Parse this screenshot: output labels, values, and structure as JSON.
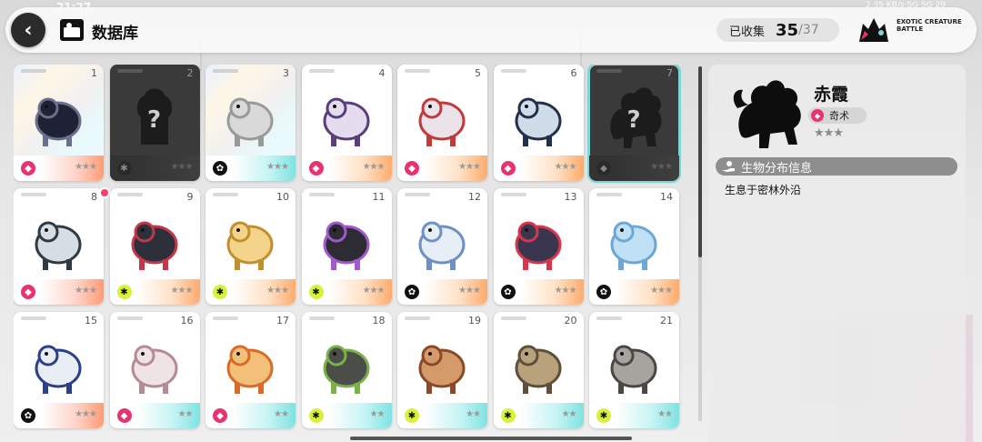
{
  "status_bar": {
    "time": "21:27",
    "right_text": "2.35 KB/s  5G  5G  29"
  },
  "header": {
    "back_icon": "chevron-left-icon",
    "title": "数据库",
    "collected_label": "已收集",
    "collected_count": "35",
    "collected_total": "/37",
    "logo_text": "EXOTIC CREATURE BATTLE"
  },
  "cards": [
    {
      "num": "1",
      "type": "arcane",
      "stars": "★★★",
      "state": "holo",
      "footer": "pink",
      "art": "dragon-dark"
    },
    {
      "num": "2",
      "type": "nature",
      "stars": "★★★",
      "state": "locked",
      "footer": "dark",
      "art": "unknown"
    },
    {
      "num": "3",
      "type": "dark",
      "stars": "★★★",
      "state": "holo",
      "footer": "cyan",
      "art": "statue"
    },
    {
      "num": "4",
      "type": "arcane",
      "stars": "★★★",
      "state": "normal",
      "footer": "orange",
      "art": "sheep-witch"
    },
    {
      "num": "5",
      "type": "arcane",
      "stars": "★★★",
      "state": "normal",
      "footer": "orange",
      "art": "sheep-red"
    },
    {
      "num": "6",
      "type": "arcane",
      "stars": "★★★",
      "state": "normal",
      "footer": "orange",
      "art": "sea-dragon"
    },
    {
      "num": "7",
      "type": "arcane",
      "stars": "★★★",
      "state": "locked-selected",
      "footer": "dark",
      "art": "unknown-dragon"
    },
    {
      "num": "8",
      "type": "arcane",
      "stars": "★★★",
      "state": "normal",
      "footer": "pink",
      "art": "mushroom-beast"
    },
    {
      "num": "9",
      "type": "nature",
      "stars": "★★★",
      "state": "normal",
      "footer": "orange",
      "art": "crab-spider"
    },
    {
      "num": "10",
      "type": "nature",
      "stars": "★★★",
      "state": "normal",
      "footer": "orange",
      "art": "cat"
    },
    {
      "num": "11",
      "type": "nature",
      "stars": "★★★",
      "state": "normal",
      "footer": "orange",
      "art": "golem"
    },
    {
      "num": "12",
      "type": "dark",
      "stars": "★★★",
      "state": "normal",
      "footer": "orange",
      "art": "dog-blue"
    },
    {
      "num": "13",
      "type": "dark",
      "stars": "★★★",
      "state": "normal",
      "footer": "orange",
      "art": "wolf-red"
    },
    {
      "num": "14",
      "type": "dark",
      "stars": "★★★",
      "state": "normal",
      "footer": "orange",
      "art": "ice-block"
    },
    {
      "num": "15",
      "type": "dark",
      "stars": "★★★",
      "state": "normal",
      "footer": "pink",
      "art": "flower-beast"
    },
    {
      "num": "16",
      "type": "arcane",
      "stars": "★★",
      "state": "normal",
      "footer": "cyan",
      "art": "hairy-mound"
    },
    {
      "num": "17",
      "type": "arcane",
      "stars": "★★",
      "state": "normal",
      "footer": "cyan",
      "art": "fire-ferret"
    },
    {
      "num": "18",
      "type": "nature",
      "stars": "★★",
      "state": "normal",
      "footer": "cyan",
      "art": "moss-bear"
    },
    {
      "num": "19",
      "type": "nature",
      "stars": "★★",
      "state": "normal",
      "footer": "cyan",
      "art": "spike-bear"
    },
    {
      "num": "20",
      "type": "nature",
      "stars": "★★",
      "state": "normal",
      "footer": "cyan",
      "art": "boar"
    },
    {
      "num": "21",
      "type": "nature",
      "stars": "★★",
      "state": "normal",
      "footer": "cyan",
      "art": "rhino-pack"
    }
  ],
  "detail": {
    "name": "赤霞",
    "type_label": "奇术",
    "type": "arcane",
    "stars": "★★★",
    "section_icon": "hand-plant-icon",
    "section_title": "生物分布信息",
    "habitat": "生息于密林外沿"
  },
  "colors": {
    "arcane": "#e8336f",
    "nature": "#d8f23a",
    "dark": "#111111",
    "selected_outline": "#7fd6d6"
  }
}
